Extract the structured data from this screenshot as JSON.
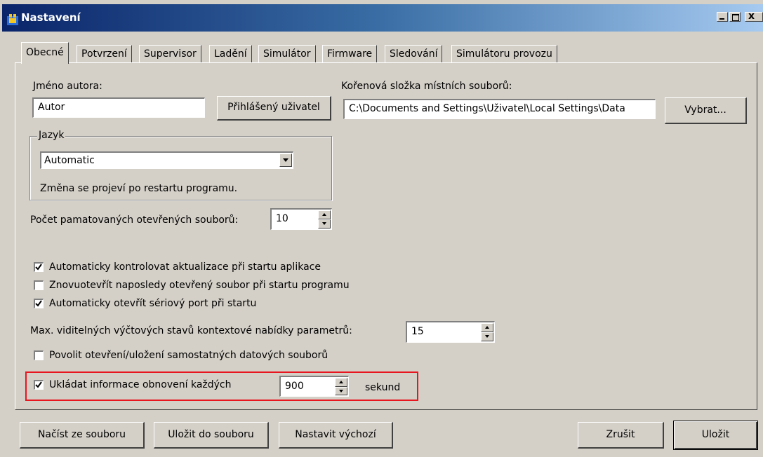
{
  "window": {
    "title": "Nastavení"
  },
  "tabs": [
    "Obecné",
    "Potvrzení",
    "Supervisor",
    "Ladění",
    "Simulátor",
    "Firmware",
    "Sledování",
    "Simulátoru provozu"
  ],
  "author": {
    "label": "Jméno autora:",
    "value": "Autor",
    "button": "Přihlášený uživatel"
  },
  "root_folder": {
    "label": "Kořenová složka místních souborů:",
    "value": "C:\\Documents and Settings\\Uživatel\\Local Settings\\Data",
    "button": "Vybrat..."
  },
  "language": {
    "group_title": "Jazyk",
    "selected": "Automatic",
    "note": "Změna se projeví po restartu programu."
  },
  "recent_files": {
    "label": "Počet pamatovaných otevřených souborů:",
    "value": "10"
  },
  "checkboxes": [
    {
      "label": "Automaticky kontrolovat aktualizace při startu aplikace",
      "checked": true
    },
    {
      "label": "Znovuotevřít naposledy otevřený soubor při startu programu",
      "checked": false
    },
    {
      "label": "Automaticky otevřít sériový port při startu",
      "checked": true
    }
  ],
  "max_enum": {
    "label": "Max. viditelných výčtových stavů kontextové nabídky parametrů:",
    "value": "15"
  },
  "allow_standalone": {
    "label": "Povolit otevření/uložení samostatných datových souborů",
    "checked": false
  },
  "autosave": {
    "label": "Ukládat informace obnovení každých",
    "checked": true,
    "value": "900",
    "unit": "sekund"
  },
  "footer": {
    "load": "Načíst ze souboru",
    "save_file": "Uložit do souboru",
    "defaults": "Nastavit výchozí",
    "cancel": "Zrušit",
    "save": "Uložit"
  },
  "colors": {
    "highlight": "#e8161f",
    "titlebar": "#0a246a"
  }
}
